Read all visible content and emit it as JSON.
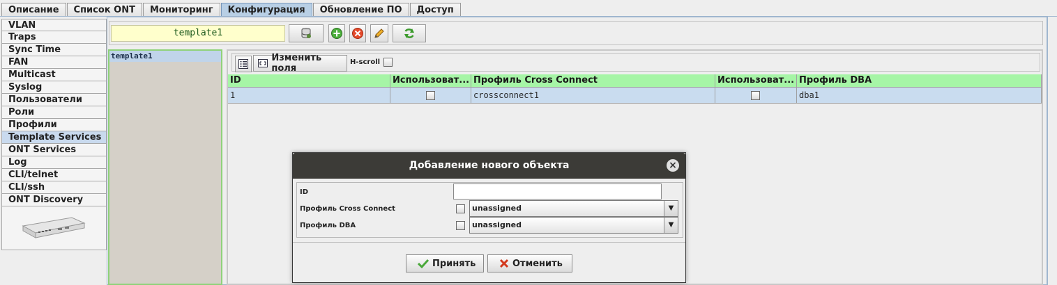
{
  "tabs": [
    "Описание",
    "Список ONT",
    "Мониторинг",
    "Конфигурация",
    "Обновление ПО",
    "Доступ"
  ],
  "active_tab": "Конфигурация",
  "nav": {
    "items": [
      "VLAN",
      "Traps",
      "Sync Time",
      "FAN",
      "Multicast",
      "Syslog",
      "Пользователи",
      "Роли",
      "Профили",
      "Template Services",
      "ONT Services",
      "Log",
      "CLI/telnet",
      "CLI/ssh",
      "ONT Discovery"
    ],
    "active": "Template Services"
  },
  "toolbar": {
    "template_name": "template1"
  },
  "template_list": [
    "template1"
  ],
  "inner_toolbar": {
    "edit_fields_label": "Изменить поля",
    "hscroll_label": "H-scroll"
  },
  "table": {
    "columns": [
      "ID",
      "Использоват...",
      "Профиль Cross Connect",
      "Использоват...",
      "Профиль DBA"
    ],
    "rows": [
      {
        "id": "1",
        "use_cc": false,
        "cross_connect": "crossconnect1",
        "use_dba": false,
        "dba": "dba1"
      }
    ]
  },
  "dialog": {
    "title": "Добавление нового объекта",
    "fields": {
      "id_label": "ID",
      "id_value": "",
      "cc_label": "Профиль Cross Connect",
      "cc_value": "unassigned",
      "dba_label": "Профиль DBA",
      "dba_value": "unassigned"
    },
    "accept_label": "Принять",
    "cancel_label": "Отменить"
  },
  "colors": {
    "header_green": "#a6f5a6",
    "selected_row": "#c9dcef",
    "template_field_bg": "#ffffcc",
    "dialog_title_bg": "#3c3b37"
  }
}
